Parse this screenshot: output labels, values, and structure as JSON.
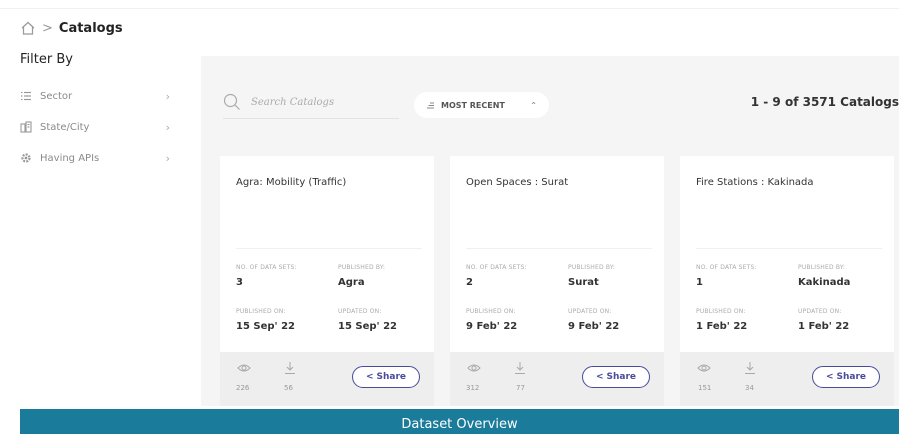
{
  "breadcrumb": {
    "separator": ">",
    "current": "Catalogs"
  },
  "filters": {
    "title": "Filter By",
    "items": [
      {
        "label": "Sector",
        "icon": "list-icon"
      },
      {
        "label": "State/City",
        "icon": "building-icon"
      },
      {
        "label": "Having APIs",
        "icon": "gear-icon"
      }
    ]
  },
  "search": {
    "placeholder": "Search Catalogs"
  },
  "sort": {
    "label": "MOST RECENT"
  },
  "results": {
    "count_text": "1 - 9 of 3571 Catalogs"
  },
  "card_labels": {
    "datasets": "NO. OF DATA SETS:",
    "published_by": "PUBLISHED BY:",
    "published_on": "PUBLISHED ON:",
    "updated_on": "UPDATED ON:",
    "share": "Share"
  },
  "cards": [
    {
      "title": "Agra: Mobility (Traffic)",
      "datasets": "3",
      "published_by": "Agra",
      "published_on": "15 Sep' 22",
      "updated_on": "15 Sep' 22",
      "views": "226",
      "downloads": "56"
    },
    {
      "title": "Open Spaces : Surat",
      "datasets": "2",
      "published_by": "Surat",
      "published_on": "9 Feb' 22",
      "updated_on": "9 Feb' 22",
      "views": "312",
      "downloads": "77"
    },
    {
      "title": "Fire Stations : Kakinada",
      "datasets": "1",
      "published_by": "Kakinada",
      "published_on": "1 Feb' 22",
      "updated_on": "1 Feb' 22",
      "views": "151",
      "downloads": "34"
    }
  ],
  "overview": {
    "label": "Dataset Overview"
  },
  "colors": {
    "accent": "#1a7c9a",
    "share": "#4a4a9c",
    "panel_bg": "#f5f5f5"
  }
}
